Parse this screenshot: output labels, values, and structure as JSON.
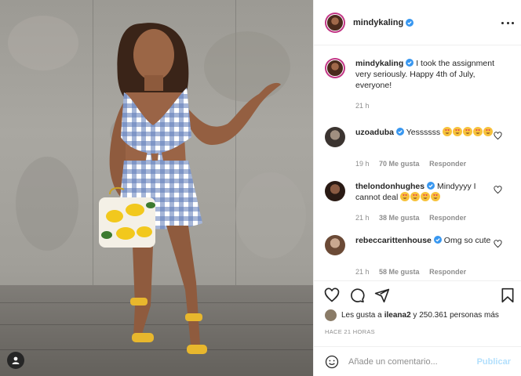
{
  "photo": {
    "alt_icon": "person-tag-icon"
  },
  "post": {
    "author": "mindykaling",
    "caption": "I took the assignment very seriously. Happy 4th of July, everyone!",
    "caption_time": "21 h",
    "likes_user": "ileana2",
    "likes_text_prefix": "Les gusta a ",
    "likes_text_suffix": " y 250.361 personas más",
    "timestamp": "HACE 21 HORAS"
  },
  "comments": [
    {
      "user": "uzoaduba",
      "text": "Yessssss",
      "emoji_count": 5,
      "time": "19 h",
      "likes": "70 Me gusta",
      "reply": "Responder"
    },
    {
      "user": "thelondonhughes",
      "text": "Mindyyyy I cannot deal",
      "emoji_count": 4,
      "time": "21 h",
      "likes": "38 Me gusta",
      "reply": "Responder"
    },
    {
      "user": "rebeccarittenhouse",
      "text": "Omg so cute",
      "emoji_count": 0,
      "time": "21 h",
      "likes": "58 Me gusta",
      "reply": "Responder"
    }
  ],
  "composer": {
    "placeholder": "Añade un comentario...",
    "publish_label": "Publicar"
  },
  "colors": {
    "verified": "#3897f0",
    "publish_disabled": "#b2dffc",
    "secondary_text": "#8e8e8e",
    "divider": "#efefef"
  }
}
